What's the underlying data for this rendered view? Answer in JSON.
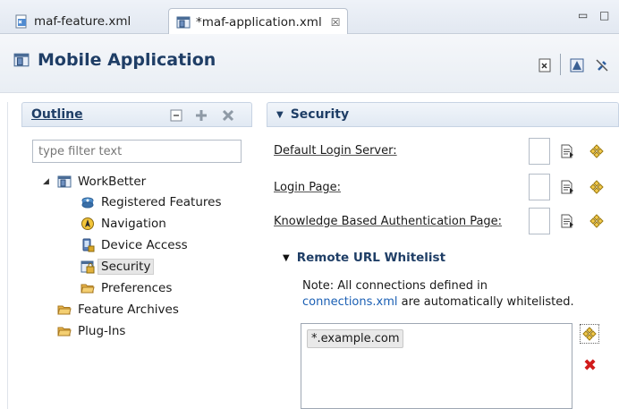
{
  "tabs": [
    {
      "label": "maf-feature.xml",
      "active": false
    },
    {
      "label": "*maf-application.xml",
      "active": true,
      "close_glyph": "☒"
    }
  ],
  "window_controls": {
    "minimize": "▭",
    "maximize": "□"
  },
  "form": {
    "title": "Mobile Application"
  },
  "outline": {
    "title": "Outline",
    "filter_placeholder": "type filter text",
    "root": "WorkBetter",
    "children": [
      "Registered Features",
      "Navigation",
      "Device Access",
      "Security",
      "Preferences"
    ],
    "selected": "Security",
    "top_level": [
      "Feature Archives",
      "Plug-Ins"
    ]
  },
  "security": {
    "title": "Security",
    "fields": [
      {
        "label": "Default Login Server:",
        "value": ""
      },
      {
        "label": "Login Page:",
        "value": ""
      },
      {
        "label": "Knowledge Based Authentication Page:",
        "value": ""
      }
    ],
    "whitelist": {
      "title": "Remote URL Whitelist",
      "note_prefix": "Note: All connections defined in",
      "note_link": "connections.xml",
      "note_suffix": " are automatically whitelisted.",
      "items": [
        "*.example.com"
      ]
    }
  },
  "colors": {
    "header_text": "#1f3e66",
    "link": "#1a5fb4",
    "delete": "#d11b1b",
    "folder": "#e8b44a"
  }
}
